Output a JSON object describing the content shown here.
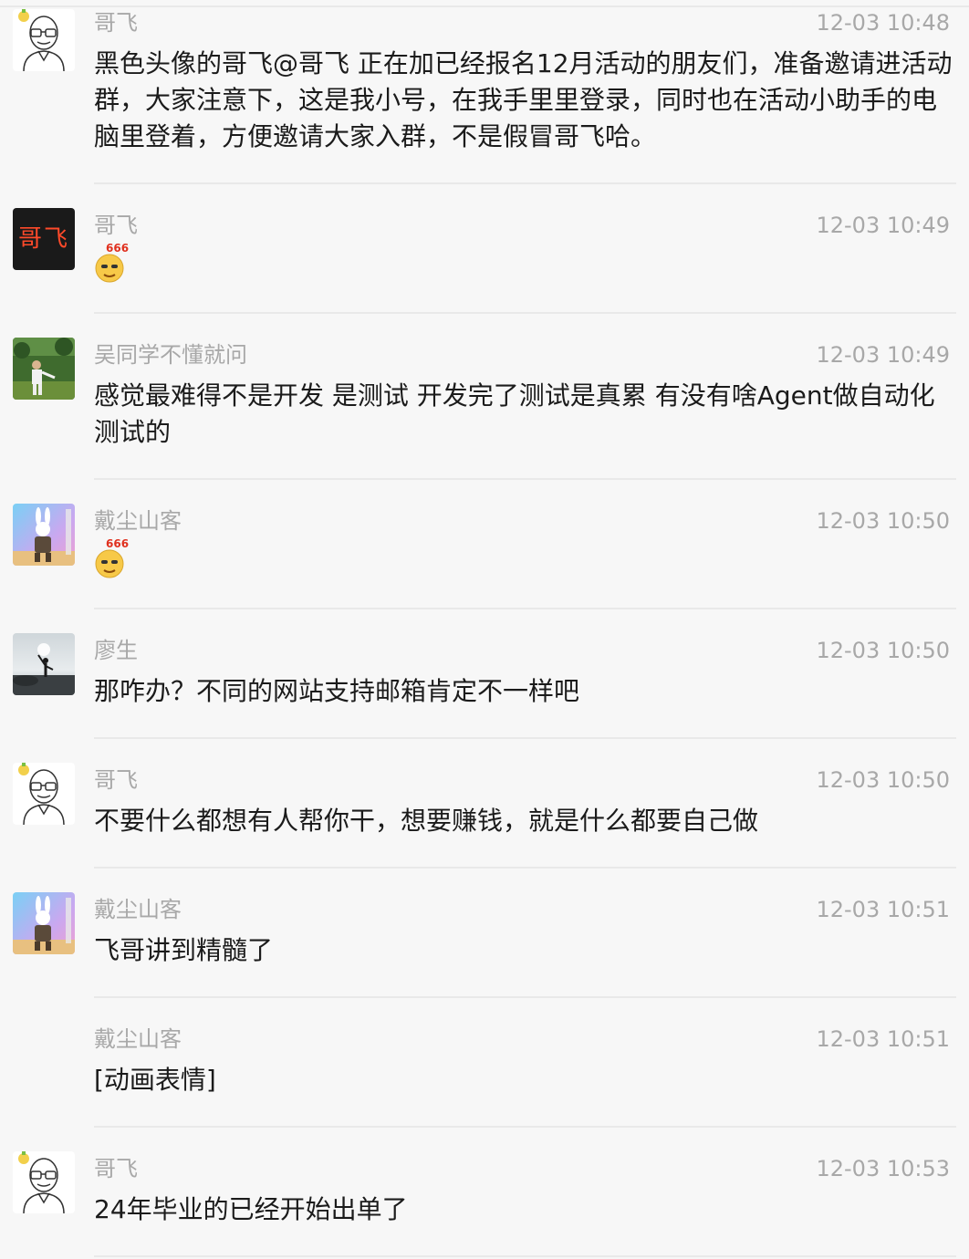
{
  "messages": [
    {
      "sender": "哥飞",
      "time": "12-03 10:48",
      "text": "黑色头像的哥飞@哥飞  正在加已经报名12月活动的朋友们，准备邀请进活动群，大家注意下，这是我小号，在我手里里登录，同时也在活动小助手的电脑里登着，方便邀请大家入群，不是假冒哥飞哈。",
      "avatar_icon": "bald-man-glasses-avatar"
    },
    {
      "sender": "哥飞",
      "time": "12-03 10:49",
      "sticker": "666-emoji",
      "avatar_text": "哥飞",
      "avatar_icon": "black-text-avatar"
    },
    {
      "sender": "吴同学不懂就问",
      "time": "12-03 10:49",
      "text": "感觉最难得不是开发 是测试  开发完了测试是真累  有没有啥Agent做自动化测试的",
      "avatar_icon": "outdoor-photo-avatar"
    },
    {
      "sender": "戴尘山客",
      "time": "12-03 10:50",
      "sticker": "666-emoji",
      "avatar_icon": "rabbit-warrior-avatar"
    },
    {
      "sender": "廖生",
      "time": "12-03 10:50",
      "text": "那咋办？不同的网站支持邮箱肯定不一样吧",
      "avatar_icon": "seaside-silhouette-avatar"
    },
    {
      "sender": "哥飞",
      "time": "12-03 10:50",
      "text": "不要什么都想有人帮你干，想要赚钱，就是什么都要自己做",
      "avatar_icon": "bald-man-glasses-avatar"
    },
    {
      "sender": "戴尘山客",
      "time": "12-03 10:51",
      "text": "飞哥讲到精髓了",
      "avatar_icon": "rabbit-warrior-avatar"
    },
    {
      "sender": "戴尘山客",
      "time": "12-03 10:51",
      "text": "[动画表情]"
    },
    {
      "sender": "哥飞",
      "time": "12-03 10:53",
      "text": "24年毕业的已经开始出单了",
      "avatar_icon": "bald-man-glasses-avatar"
    }
  ],
  "colors": {
    "background": "#f7f7f7",
    "meta_text": "#a8a8a8",
    "body_text": "#1b1b1b",
    "divider": "#e9e9e9"
  }
}
